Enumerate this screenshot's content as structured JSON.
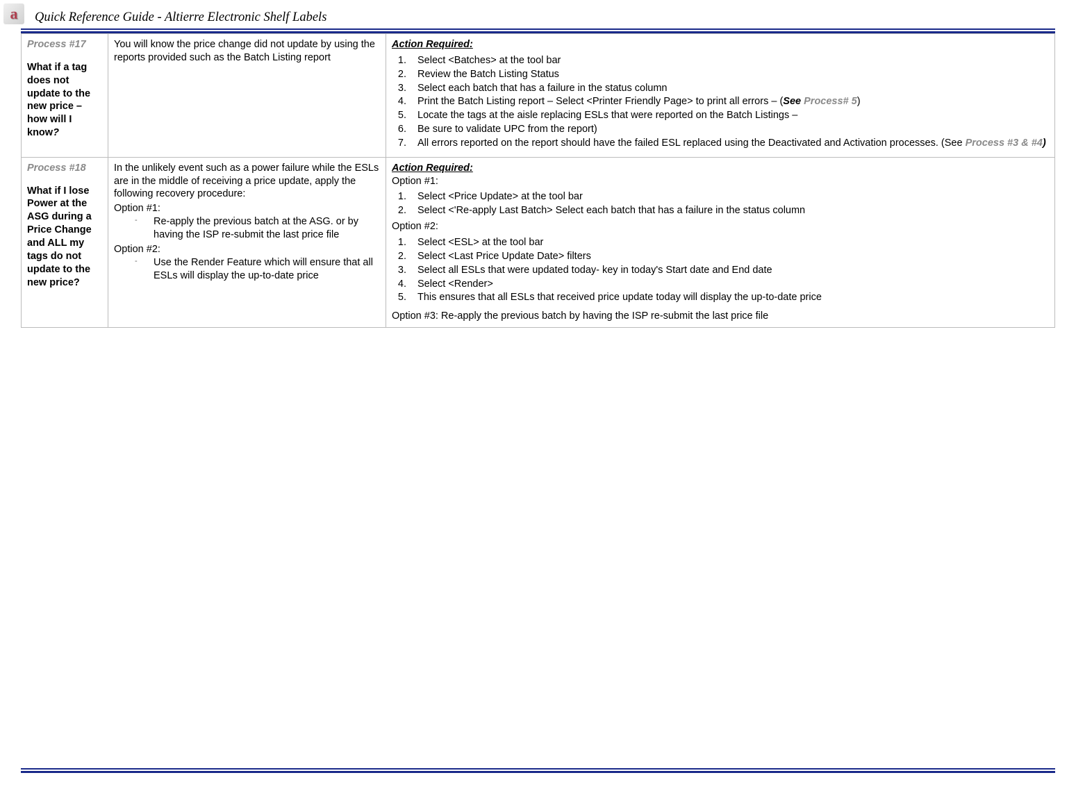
{
  "logo_letter": "a",
  "header": "Quick Reference Guide - Altierre Electronic Shelf Labels",
  "row17": {
    "process_num": "Process #17",
    "title1": "What if a tag does not update to the new price – how will I know",
    "title_q": "?",
    "desc": "You will know the price change did not update by using the reports provided such as the Batch Listing report",
    "action_heading": "Action Required:",
    "steps": {
      "s1": "Select <Batches> at the tool bar",
      "s2": "Review the Batch Listing Status",
      "s3": "Select each batch that has a failure in the status column",
      "s4_a": "Print the Batch Listing report – Select <Printer Friendly Page> to print all errors – (",
      "s4_see": "See ",
      "s4_ref": "Process# 5",
      "s4_end": ")",
      "s5": "Locate the tags at the aisle replacing ESLs that were reported on the Batch Listings –",
      "s6": "Be sure to validate UPC from the report)",
      "s7_a": "All errors reported on the report should have the failed ESL replaced using the Deactivated and Activation processes. (See ",
      "s7_ref": "Process #3 & #4",
      "s7_end": ")"
    }
  },
  "row18": {
    "process_num": "Process #18",
    "title": "What if I lose Power at the ASG during a Price Change and ALL my tags do not update to the new price?",
    "desc_intro": "In the unlikely event such as a power failure while the ESLs are in the middle of receiving a price update, apply the following recovery procedure:",
    "opt1_label": "Option #1:",
    "opt1_bullet": "Re-apply the previous batch at the ASG.  or by having the ISP re-submit the last price file",
    "opt2_label": "Option #2:",
    "opt2_bullet": "Use the Render Feature which will ensure that all ESLs will display the up-to-date price",
    "action_heading": "Action Required:",
    "ropt1_label": "Option #1:",
    "ropt1_steps": {
      "s1": "Select <Price Update> at the tool bar",
      "s2": "Select <'Re-apply Last Batch> Select each batch that has a failure in the status column"
    },
    "ropt2_label": "Option #2:",
    "ropt2_steps": {
      "s1": "Select <ESL> at the tool bar",
      "s2": "Select <Last Price Update Date> filters",
      "s3": "Select all ESLs that were updated today- key in today's Start date and End date",
      "s4": "Select <Render>",
      "s5": "This ensures that all ESLs that received price update today will display the up-to-date price"
    },
    "ropt3": "Option #3:  Re-apply the previous batch by having the ISP re-submit the last price file"
  }
}
